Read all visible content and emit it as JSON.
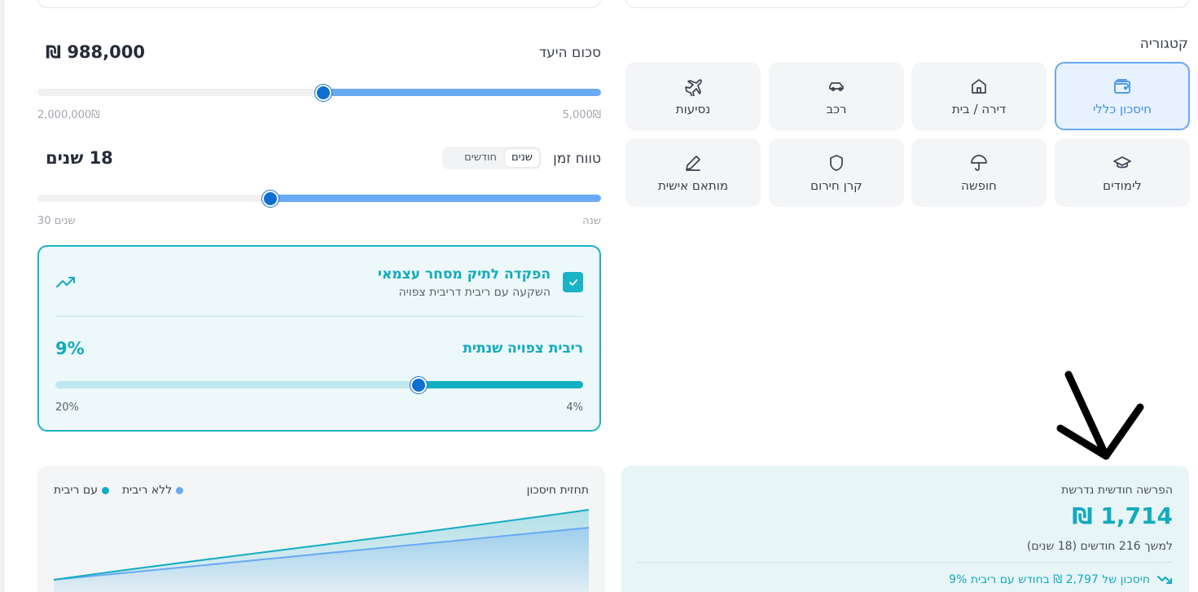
{
  "categories": {
    "title": "קטגוריה",
    "items": [
      {
        "label": "חיסכון כללי",
        "icon": "wallet-icon",
        "active": true
      },
      {
        "label": "דירה / בית",
        "icon": "home-icon"
      },
      {
        "label": "רכב",
        "icon": "car-icon"
      },
      {
        "label": "נסיעות",
        "icon": "plane-icon"
      },
      {
        "label": "לימודים",
        "icon": "graduation-cap-icon"
      },
      {
        "label": "חופשה",
        "icon": "umbrella-icon"
      },
      {
        "label": "קרן חירום",
        "icon": "shield-icon"
      },
      {
        "label": "מותאם אישית",
        "icon": "pencil-icon"
      }
    ]
  },
  "goal": {
    "label": "סכום היעד",
    "value": "988,000 ₪",
    "min_label": "5,000₪",
    "max_label": "2,000,000₪",
    "slider_value": 988000,
    "slider_min": 5000,
    "slider_max": 2000000
  },
  "timeframe": {
    "label": "טווח זמן",
    "toggle": {
      "years": "שנים",
      "months": "חודשים",
      "selected": "years"
    },
    "value": "18 שנים",
    "min_label": "שנה",
    "max_label": "30 שנים",
    "slider_value": 18,
    "slider_min": 1,
    "slider_max": 30
  },
  "investment": {
    "checked": true,
    "title": "הפקדה לתיק מסחר עצמאי",
    "subtitle": "השקעה עם ריבית דריבית צפויה",
    "icon": "trending-up-icon",
    "rate_label": "ריבית צפויה שנתית",
    "rate_value": "9%",
    "min_label": "4%",
    "max_label": "20%",
    "slider_value": 9,
    "slider_min": 4,
    "slider_max": 20
  },
  "forecast": {
    "title": "תחזית חיסכון",
    "legend_no_interest": "ללא ריבית",
    "legend_with_interest": "עם ריבית",
    "colors": {
      "no_interest": "#6aa9f4",
      "with_interest": "#12aec1"
    }
  },
  "result": {
    "title": "הפרשה חודשית נדרשת",
    "amount": "1,714 ₪",
    "duration": "למשך 216 חודשים (18 שנים)",
    "saving_note": "חיסכון של 2,797 ₪ בחודש עם ריבית 9%",
    "icon": "trending-down-icon"
  },
  "colors": {
    "accent_blue": "#3d8fe9",
    "accent_teal": "#12aabd"
  }
}
